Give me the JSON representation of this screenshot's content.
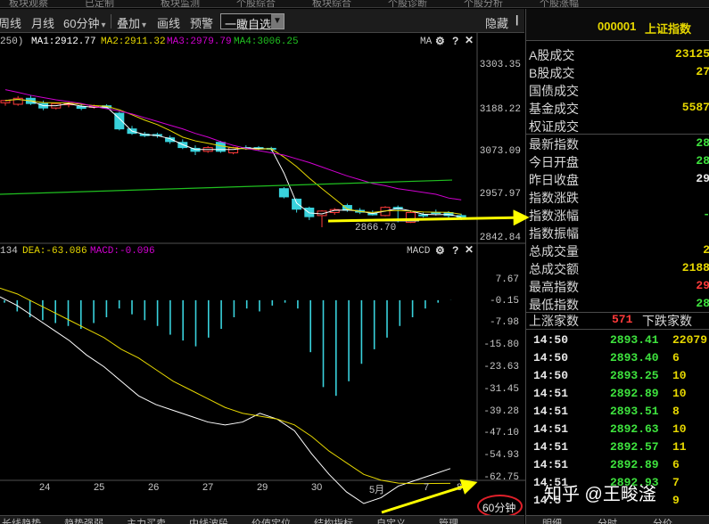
{
  "top_menu": [
    "板块观察",
    "已定制",
    "板块监测",
    "个股综合",
    "板块综合",
    "个股诊断",
    "个股分析",
    "个股涨幅"
  ],
  "toolbar": {
    "items": [
      "周线",
      "月线",
      "60分钟",
      "叠加",
      "画线",
      "预警"
    ],
    "selector": "一瞰自选",
    "hide": "隐藏"
  },
  "main_indicators": {
    "prefix": "250)",
    "ma1": "MA1:2912.77",
    "ma2": "MA2:2911.32",
    "ma3": "MA3:2979.79",
    "ma4": "MA4:3006.25",
    "panel_tag": "MA"
  },
  "macd_indicators": {
    "prefix": "134",
    "dea": "DEA:-63.086",
    "macd": "MACD:-0.096",
    "panel_tag": "MACD"
  },
  "low_marker": "2866.70",
  "price_axis": [
    "3303.35",
    "3188.22",
    "3073.09",
    "2957.97",
    "2842.84"
  ],
  "macd_axis": [
    "7.67",
    "-0.15",
    "-7.98",
    "-15.80",
    "-23.63",
    "-31.45",
    "-39.28",
    "-47.10",
    "-54.93",
    "-62.75"
  ],
  "x_axis": [
    "24",
    "25",
    "26",
    "27",
    "29",
    "30",
    "5月",
    "7",
    "8"
  ],
  "period": "60分钟",
  "bottom_tabs": [
    "长线趋势",
    "趋势强弱",
    "主力买卖",
    "中线波段",
    "价值定位",
    "结构指标",
    "自定义",
    "管理"
  ],
  "right_panel": {
    "code": "000001",
    "name": "上证指数",
    "rows": [
      {
        "label": "A股成交",
        "value": "23125",
        "color": "#e6d700"
      },
      {
        "label": "B股成交",
        "value": "27",
        "color": "#e6d700"
      },
      {
        "label": "国债成交",
        "value": "",
        "color": "#e6d700"
      },
      {
        "label": "基金成交",
        "value": "5587",
        "color": "#e6d700"
      },
      {
        "label": "权证成交",
        "value": "",
        "color": "#e6d700"
      },
      {
        "label": "最新指数",
        "value": "28",
        "color": "#3ee33e"
      },
      {
        "label": "今日开盘",
        "value": "28",
        "color": "#3ee33e"
      },
      {
        "label": "昨日收盘",
        "value": "29",
        "color": "#e8e8e8"
      },
      {
        "label": "指数涨跌",
        "value": "",
        "color": "#3ee33e"
      },
      {
        "label": "指数涨幅",
        "value": "-",
        "color": "#3ee33e"
      },
      {
        "label": "指数振幅",
        "value": "",
        "color": "#e8e8e8"
      },
      {
        "label": "总成交量",
        "value": "2",
        "color": "#e6d700"
      },
      {
        "label": "总成交额",
        "value": "2188",
        "color": "#e6d700"
      },
      {
        "label": "最高指数",
        "value": "29",
        "color": "#ff3a3a"
      },
      {
        "label": "最低指数",
        "value": "28",
        "color": "#3ee33e"
      }
    ],
    "breadth": {
      "up_label": "上涨家数",
      "up_value": "571",
      "down_label": "下跌家数"
    },
    "ticks": [
      {
        "time": "14:50",
        "price": "2893.41",
        "vol": "22079"
      },
      {
        "time": "14:50",
        "price": "2893.40",
        "vol": "6"
      },
      {
        "time": "14:50",
        "price": "2893.25",
        "vol": "10"
      },
      {
        "time": "14:51",
        "price": "2892.89",
        "vol": "10"
      },
      {
        "time": "14:51",
        "price": "2893.51",
        "vol": "8"
      },
      {
        "time": "14:51",
        "price": "2892.63",
        "vol": "10"
      },
      {
        "time": "14:51",
        "price": "2892.57",
        "vol": "11"
      },
      {
        "time": "14:51",
        "price": "2892.89",
        "vol": "6"
      },
      {
        "time": "14:51",
        "price": "2892.93",
        "vol": "7"
      },
      {
        "time": "14:5",
        "price": "",
        "vol": "9"
      }
    ],
    "footer": [
      "明细",
      "分时",
      "分价"
    ]
  },
  "watermark": "知乎 @王畯滏",
  "colors": {
    "up": "#ff3a3a",
    "down": "#39d2dc",
    "ma1": "#ffffff",
    "ma2": "#e6d700",
    "ma3": "#d000d0",
    "ma4": "#20c020",
    "arrow": "#ffff00",
    "circle": "#e0202a"
  },
  "chart_data": [
    {
      "type": "candlestick",
      "title": "上证指数 60分钟",
      "x_ticks": [
        "24",
        "25",
        "26",
        "27",
        "29",
        "30",
        "5月",
        "7",
        "8"
      ],
      "ylim": [
        2842.84,
        3303.35
      ],
      "y_ticks": [
        3303.35,
        3188.22,
        3073.09,
        2957.97,
        2842.84
      ],
      "series": [
        {
          "name": "MA1",
          "value_last": 2912.77
        },
        {
          "name": "MA2",
          "value_last": 2911.32
        },
        {
          "name": "MA3",
          "value_last": 2979.79
        },
        {
          "name": "MA4",
          "value_last": 3006.25
        }
      ],
      "annotations": [
        "2866.70"
      ],
      "candles": [
        {
          "o": 3200,
          "h": 3208,
          "c": 3206,
          "l": 3192
        },
        {
          "o": 3196,
          "h": 3218,
          "c": 3212,
          "l": 3192
        },
        {
          "o": 3212,
          "h": 3220,
          "c": 3198,
          "l": 3194
        },
        {
          "o": 3198,
          "h": 3206,
          "c": 3186,
          "l": 3180
        },
        {
          "o": 3186,
          "h": 3200,
          "c": 3198,
          "l": 3182
        },
        {
          "o": 3196,
          "h": 3203,
          "c": 3197,
          "l": 3188
        },
        {
          "o": 3190,
          "h": 3196,
          "c": 3185,
          "l": 3180
        },
        {
          "o": 3188,
          "h": 3195,
          "c": 3191,
          "l": 3184
        },
        {
          "o": 3192,
          "h": 3196,
          "c": 3186,
          "l": 3183
        },
        {
          "o": 3172,
          "h": 3176,
          "c": 3130,
          "l": 3126
        },
        {
          "o": 3130,
          "h": 3138,
          "c": 3118,
          "l": 3114
        },
        {
          "o": 3116,
          "h": 3122,
          "c": 3112,
          "l": 3108
        },
        {
          "o": 3115,
          "h": 3120,
          "c": 3112,
          "l": 3106
        },
        {
          "o": 3106,
          "h": 3112,
          "c": 3096,
          "l": 3090
        },
        {
          "o": 3094,
          "h": 3102,
          "c": 3080,
          "l": 3076
        },
        {
          "o": 3078,
          "h": 3086,
          "c": 3070,
          "l": 3060
        },
        {
          "o": 3070,
          "h": 3084,
          "c": 3080,
          "l": 3066
        },
        {
          "o": 3094,
          "h": 3098,
          "c": 3070,
          "l": 3066
        },
        {
          "o": 3066,
          "h": 3082,
          "c": 3080,
          "l": 3062
        },
        {
          "o": 3080,
          "h": 3086,
          "c": 3078,
          "l": 3074
        },
        {
          "o": 3080,
          "h": 3084,
          "c": 3077,
          "l": 3073
        },
        {
          "o": 3078,
          "h": 3082,
          "c": 3076,
          "l": 3070
        },
        {
          "o": 2970,
          "h": 2974,
          "c": 2948,
          "l": 2944
        },
        {
          "o": 2942,
          "h": 2944,
          "c": 2915,
          "l": 2906
        },
        {
          "o": 2918,
          "h": 2922,
          "c": 2895,
          "l": 2886
        },
        {
          "o": 2898,
          "h": 2912,
          "c": 2910,
          "l": 2866.7
        },
        {
          "o": 2906,
          "h": 2918,
          "c": 2914,
          "l": 2900
        },
        {
          "o": 2925,
          "h": 2930,
          "c": 2912,
          "l": 2908
        },
        {
          "o": 2912,
          "h": 2918,
          "c": 2907,
          "l": 2902
        },
        {
          "o": 2904,
          "h": 2912,
          "c": 2900,
          "l": 2898
        },
        {
          "o": 2898,
          "h": 2923,
          "c": 2920,
          "l": 2896
        },
        {
          "o": 2920,
          "h": 2925,
          "c": 2915,
          "l": 2880
        },
        {
          "o": 2880,
          "h": 2912,
          "c": 2906,
          "l": 2878
        },
        {
          "o": 2900,
          "h": 2906,
          "c": 2897,
          "l": 2893
        },
        {
          "o": 2906,
          "h": 2914,
          "c": 2904,
          "l": 2898
        },
        {
          "o": 2906,
          "h": 2910,
          "c": 2898,
          "l": 2892
        },
        {
          "o": 2898,
          "h": 2903,
          "c": 2890,
          "l": 2886
        }
      ]
    },
    {
      "type": "macd",
      "ylim": [
        -70,
        9
      ],
      "y_ticks": [
        7.67,
        -0.15,
        -7.98,
        -15.8,
        -23.63,
        -31.45,
        -39.28,
        -47.1,
        -54.93,
        -62.75
      ],
      "legend": [
        "DEA:-63.086",
        "MACD:-0.096"
      ],
      "histogram": [
        -1,
        -4,
        -6,
        -7,
        -8,
        -9,
        -10,
        -8,
        -6,
        -3,
        -5,
        -7,
        -9,
        -12,
        -14,
        -16,
        -13,
        -10,
        -6,
        -3,
        -4,
        -2,
        -1,
        -3,
        -18,
        -30,
        -33,
        -28,
        -22,
        -17,
        -13,
        -9,
        -6,
        -3,
        -1,
        -0.1
      ],
      "dif": [
        1,
        -2,
        -6,
        -10,
        -14,
        -19,
        -23,
        -28,
        -33,
        -36,
        -38,
        -40,
        -42,
        -43,
        -42,
        -39,
        -41,
        -45,
        -53,
        -60,
        -66,
        -70,
        -68,
        -64,
        -62,
        -60,
        -58
      ],
      "dea": [
        4,
        2,
        -1,
        -4,
        -7,
        -10,
        -13,
        -17,
        -20,
        -24,
        -28,
        -31,
        -34,
        -37,
        -39,
        -40,
        -41,
        -43,
        -47,
        -52,
        -56,
        -60,
        -62,
        -63,
        -63.2,
        -63.1,
        -63.086
      ]
    }
  ]
}
